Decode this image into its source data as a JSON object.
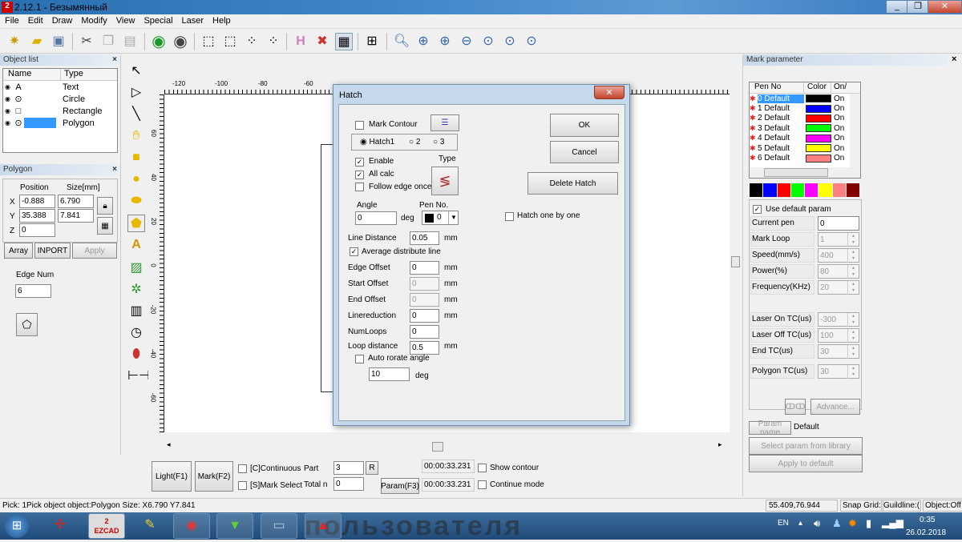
{
  "window": {
    "title": "2.12.1 - Безымянный",
    "min": "_",
    "max": "❐",
    "close": "✕"
  },
  "menu": [
    "File",
    "Edit",
    "Draw",
    "Modify",
    "View",
    "Special",
    "Laser",
    "Help"
  ],
  "object_list": {
    "title": "Object list",
    "close": "×",
    "headers": [
      "Name",
      "Type"
    ],
    "items": [
      {
        "glyph": "A",
        "type": "Text"
      },
      {
        "glyph": "⊙",
        "type": "Circle"
      },
      {
        "glyph": "□",
        "type": "Rectangle"
      },
      {
        "glyph": "⊙",
        "type": "Polygon",
        "selected": true
      }
    ]
  },
  "polygon_panel": {
    "title": "Polygon",
    "close": "×",
    "position_label": "Position",
    "size_label": "Size[mm]",
    "x_label": "X",
    "y_label": "Y",
    "z_label": "Z",
    "x_pos": "-0.888",
    "y_pos": "35.388",
    "z_pos": "0",
    "x_size": "6.790",
    "y_size": "7.841",
    "array": "Array",
    "inport": "INPORT",
    "apply": "Apply",
    "edge_num_label": "Edge Num",
    "edge_num": "6"
  },
  "ruler": {
    "top": [
      "-120",
      "-100",
      "-80",
      "-60"
    ],
    "left": [
      "60",
      "40",
      "20",
      "0",
      "-20",
      "-40",
      "-60"
    ]
  },
  "hatch": {
    "title": "Hatch",
    "close": "✕",
    "mark_contour": "Mark Contour",
    "mark_contour_checked": false,
    "hatch1": "Hatch1",
    "hatch2": "2",
    "hatch3": "3",
    "selected_hatch": "Hatch1",
    "enable": "Enable",
    "enable_checked": true,
    "all_calc": "All calc",
    "all_calc_checked": true,
    "follow_edge": "Follow edge once",
    "follow_edge_checked": false,
    "type_label": "Type",
    "angle_label": "Angle",
    "angle": "0",
    "deg": "deg",
    "pen_label": "Pen No.",
    "pen": "0",
    "line_distance_label": "Line Distance",
    "line_distance": "0.05",
    "mm": "mm",
    "avg_line": "Average distribute line",
    "avg_line_checked": true,
    "edge_offset_label": "Edge Offset",
    "edge_offset": "0",
    "start_offset_label": "Start Offset",
    "start_offset": "0",
    "end_offset_label": "End Offset",
    "end_offset": "0",
    "linereduction_label": "Linereduction",
    "linereduction": "0",
    "numloops_label": "NumLoops",
    "numloops": "0",
    "loop_distance_label": "Loop distance",
    "loop_distance": "0.5",
    "auto_rotate": "Auto rorate angle",
    "auto_rotate_checked": false,
    "auto_rotate_value": "10",
    "ok": "OK",
    "cancel": "Cancel",
    "delete": "Delete Hatch",
    "one_by_one": "Hatch one by one",
    "one_by_one_checked": false
  },
  "mark_param": {
    "title": "Mark parameter",
    "close": "×",
    "headers": [
      "Pen No",
      "Color",
      "On/"
    ],
    "pens": [
      {
        "name": "0 Default",
        "color": "#000000",
        "on": "On"
      },
      {
        "name": "1 Default",
        "color": "#0000ff",
        "on": "On"
      },
      {
        "name": "2 Default",
        "color": "#ff0000",
        "on": "On"
      },
      {
        "name": "3 Default",
        "color": "#00ff00",
        "on": "On"
      },
      {
        "name": "4 Default",
        "color": "#ff00ff",
        "on": "On"
      },
      {
        "name": "5 Default",
        "color": "#ffff00",
        "on": "On"
      },
      {
        "name": "6 Default",
        "color": "#ff8080",
        "on": "On"
      }
    ],
    "palette": [
      "#000000",
      "#0000ff",
      "#ff0000",
      "#00ff00",
      "#ff00ff",
      "#ffff00",
      "#ff8080",
      "#800000"
    ],
    "use_default": "Use default param",
    "use_default_checked": true,
    "fields": [
      {
        "label": "Current pen",
        "value": "0"
      },
      {
        "label": "Mark Loop",
        "value": "1"
      },
      {
        "label": "Speed(mm/s)",
        "value": "400"
      },
      {
        "label": "Power(%)",
        "value": "80"
      },
      {
        "label": "Frequency(KHz)",
        "value": "20"
      },
      {
        "label": "Laser On TC(us)",
        "value": "-300"
      },
      {
        "label": "Laser Off TC(us)",
        "value": "100"
      },
      {
        "label": "End TC(us)",
        "value": "30"
      },
      {
        "label": "Polygon TC(us)",
        "value": "30"
      }
    ],
    "advance": "Advance...",
    "param_name_label": "Param name",
    "param_name": "Default",
    "select_lib": "Select param from library",
    "apply_default": "Apply to default"
  },
  "bottom": {
    "light": "Light(F1)",
    "mark": "Mark(F2)",
    "continuous": "[C]Continuous",
    "mark_select": "[S]Mark Select",
    "part_label": "Part",
    "part": "3",
    "total_label": "Total n",
    "total": "0",
    "r": "R",
    "param": "Param(F3)",
    "time1": "00:00:33.231",
    "time2": "00:00:33.231",
    "show_contour": "Show contour",
    "continue_mode": "Continue mode"
  },
  "status": {
    "text": "Pick: 1Pick object object:Polygon Size: X6.790 Y7.841",
    "coords": "55.409,76.944",
    "snap": "Snap Grid:",
    "guide": "Guildline:(",
    "object": "Object:Off"
  },
  "taskbar": {
    "lang": "EN",
    "time": "0:35",
    "date": "26.02.2018",
    "bg_text": "пользователя",
    "ezcad": "EZCAD"
  }
}
